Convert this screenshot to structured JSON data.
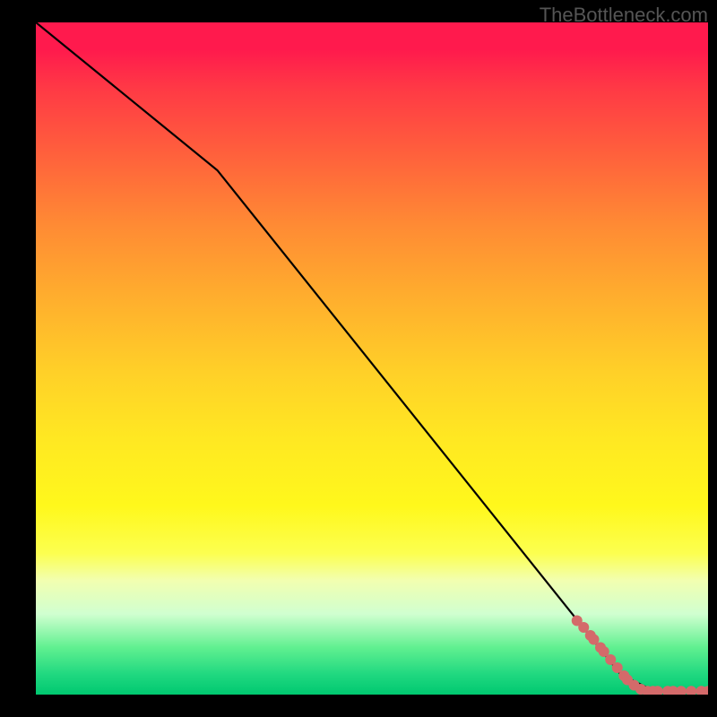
{
  "watermark": "TheBottleneck.com",
  "chart_data": {
    "type": "line",
    "title": "",
    "xlabel": "",
    "ylabel": "",
    "xlim": [
      0,
      100
    ],
    "ylim": [
      0,
      100
    ],
    "grid": false,
    "legend": false,
    "line": {
      "points": [
        {
          "x": 0,
          "y": 100
        },
        {
          "x": 27,
          "y": 78
        },
        {
          "x": 87,
          "y": 3
        },
        {
          "x": 92,
          "y": 0.5
        },
        {
          "x": 100,
          "y": 0.5
        }
      ],
      "color": "#000000"
    },
    "scatter": {
      "color": "#d46a6a",
      "radius": 6,
      "points": [
        {
          "x": 80.5,
          "y": 11
        },
        {
          "x": 81.5,
          "y": 10
        },
        {
          "x": 82.5,
          "y": 8.8
        },
        {
          "x": 83,
          "y": 8.2
        },
        {
          "x": 84,
          "y": 7
        },
        {
          "x": 84.5,
          "y": 6.4
        },
        {
          "x": 85.5,
          "y": 5.2
        },
        {
          "x": 86.5,
          "y": 4
        },
        {
          "x": 87.5,
          "y": 2.8
        },
        {
          "x": 88,
          "y": 2.2
        },
        {
          "x": 89,
          "y": 1.4
        },
        {
          "x": 90,
          "y": 0.8
        },
        {
          "x": 91,
          "y": 0.5
        },
        {
          "x": 91.8,
          "y": 0.5
        },
        {
          "x": 92.5,
          "y": 0.5
        },
        {
          "x": 94,
          "y": 0.5
        },
        {
          "x": 94.8,
          "y": 0.5
        },
        {
          "x": 96,
          "y": 0.5
        },
        {
          "x": 97.5,
          "y": 0.5
        },
        {
          "x": 99,
          "y": 0.5
        },
        {
          "x": 100,
          "y": 0.5
        }
      ]
    }
  }
}
